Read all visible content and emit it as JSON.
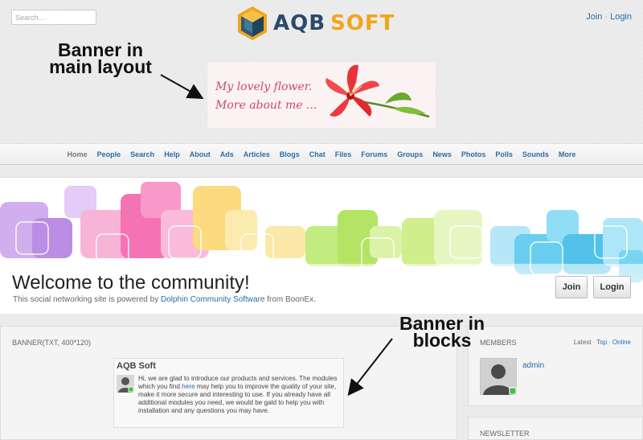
{
  "header": {
    "search_placeholder": "Search...",
    "logo_text_1": "AQB",
    "logo_text_2": "SOFT",
    "join_label": "Join",
    "login_label": "Login",
    "separator": "·"
  },
  "annotations": {
    "main_line1": "Banner in",
    "main_line2": "main layout",
    "blocks_line1": "Banner in",
    "blocks_line2": "blocks"
  },
  "banner_main": {
    "line1": "My lovely flower.",
    "line2": "More about me ..."
  },
  "nav": {
    "items": [
      "Home",
      "People",
      "Search",
      "Help",
      "About",
      "Ads",
      "Articles",
      "Blogs",
      "Chat",
      "Files",
      "Forums",
      "Groups",
      "News",
      "Photos",
      "Polls",
      "Sounds",
      "More"
    ],
    "active_index": 0
  },
  "hero": {
    "title": "Welcome to the community!",
    "sub_prefix": "This social networking site is powered by ",
    "sub_link": "Dolphin Community Software",
    "sub_suffix": " from BoonEx.",
    "join_button": "Join",
    "login_button": "Login"
  },
  "banner_block": {
    "panel_title": "BANNER(TXT, 400*120)",
    "card_title": "AQB Soft",
    "text_part1": "Hi, we are glad to introduce our products and services. The modules which you find ",
    "text_link": "here",
    "text_part2": " may help you to improve the quality of your site, make it more secure and interesting to use. If you already have all additional modules you need, we would be gald to help you with installation and any questions you may have."
  },
  "members": {
    "panel_title": "MEMBERS",
    "tab_latest": "Latest",
    "tab_top": "Top",
    "tab_online": "Online",
    "separator": "·",
    "member_name": "admin"
  },
  "newsletter": {
    "panel_title": "NEWSLETTER"
  },
  "colors": {
    "link": "#2a6da8",
    "logo_blue": "#2b4a6b",
    "logo_orange": "#f2a51a",
    "online": "#3fbf3f"
  },
  "icons": [
    "cube-logo-icon",
    "flower-icon",
    "avatar-icon",
    "online-status-icon",
    "arrow-icon"
  ]
}
